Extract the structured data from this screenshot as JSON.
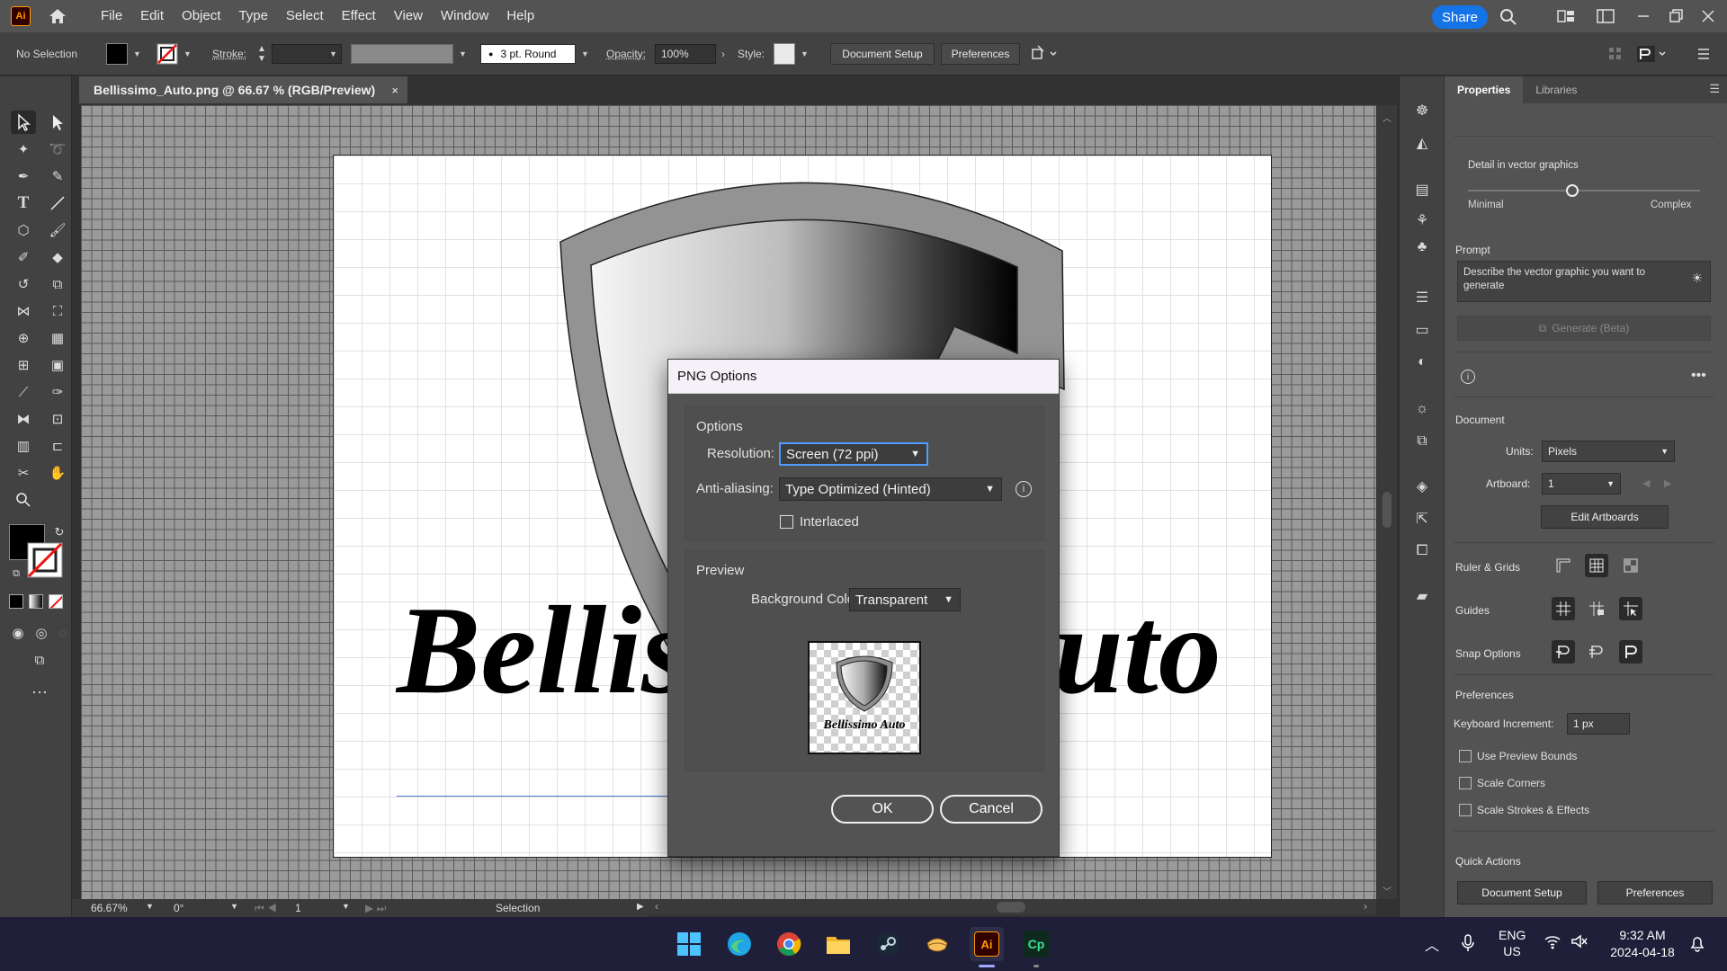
{
  "app": {
    "logo": "Ai",
    "share_label": "Share"
  },
  "menu": [
    "File",
    "Edit",
    "Object",
    "Type",
    "Select",
    "Effect",
    "View",
    "Window",
    "Help"
  ],
  "control_bar": {
    "selection_status": "No Selection",
    "stroke_label": "Stroke:",
    "brush_label": "3 pt. Round",
    "opacity_label": "Opacity:",
    "opacity_value": "100%",
    "style_label": "Style:",
    "document_setup": "Document Setup",
    "preferences": "Preferences"
  },
  "document": {
    "tab_title": "Bellissimo_Auto.png @ 66.67 % (RGB/Preview)",
    "tab_close": "×",
    "artwork_text_left": "Bellis",
    "artwork_text_right": "uto"
  },
  "status_bar": {
    "zoom": "66.67%",
    "rotation": "0°",
    "artboard": "1",
    "tool": "Selection"
  },
  "properties": {
    "tabs": [
      "Properties",
      "Libraries"
    ],
    "detail_label": "Detail in vector graphics",
    "detail_min": "Minimal",
    "detail_max": "Complex",
    "detail_value": 0.45,
    "prompt_label": "Prompt",
    "prompt_placeholder": "Describe the vector graphic you want to generate",
    "generate_label": "Generate (Beta)",
    "document_label": "Document",
    "units_label": "Units:",
    "units_value": "Pixels",
    "artboard_label": "Artboard:",
    "artboard_value": "1",
    "edit_artboards": "Edit Artboards",
    "ruler_grids": "Ruler & Grids",
    "guides": "Guides",
    "snap_options": "Snap Options",
    "preferences_label": "Preferences",
    "keyboard_increment_label": "Keyboard Increment:",
    "keyboard_increment_value": "1 px",
    "use_preview_bounds": "Use Preview Bounds",
    "scale_corners": "Scale Corners",
    "scale_strokes": "Scale Strokes & Effects",
    "quick_actions": "Quick Actions",
    "qa_document_setup": "Document Setup",
    "qa_preferences": "Preferences"
  },
  "dialog": {
    "title": "PNG Options",
    "options_group": "Options",
    "resolution_label": "Resolution:",
    "resolution_value": "Screen (72 ppi)",
    "antialiasing_label": "Anti-aliasing:",
    "antialiasing_value": "Type Optimized (Hinted)",
    "interlaced_label": "Interlaced",
    "preview_group": "Preview",
    "bg_color_label": "Background Color:",
    "bg_color_value": "Transparent",
    "preview_text": "Bellissimo Auto",
    "ok": "OK",
    "cancel": "Cancel"
  },
  "taskbar": {
    "language": "ENG",
    "region": "US",
    "time": "9:32 AM",
    "date": "2024-04-18",
    "apps": [
      "windows-start",
      "edge",
      "chrome",
      "file-explorer",
      "steam",
      "food-app",
      "illustrator",
      "capcut"
    ],
    "ai_label": "Ai",
    "cp_label": "Cp"
  },
  "colors": {
    "accent": "#1473e6",
    "focus": "#4d9cff",
    "ai_orange": "#ff9a00"
  }
}
